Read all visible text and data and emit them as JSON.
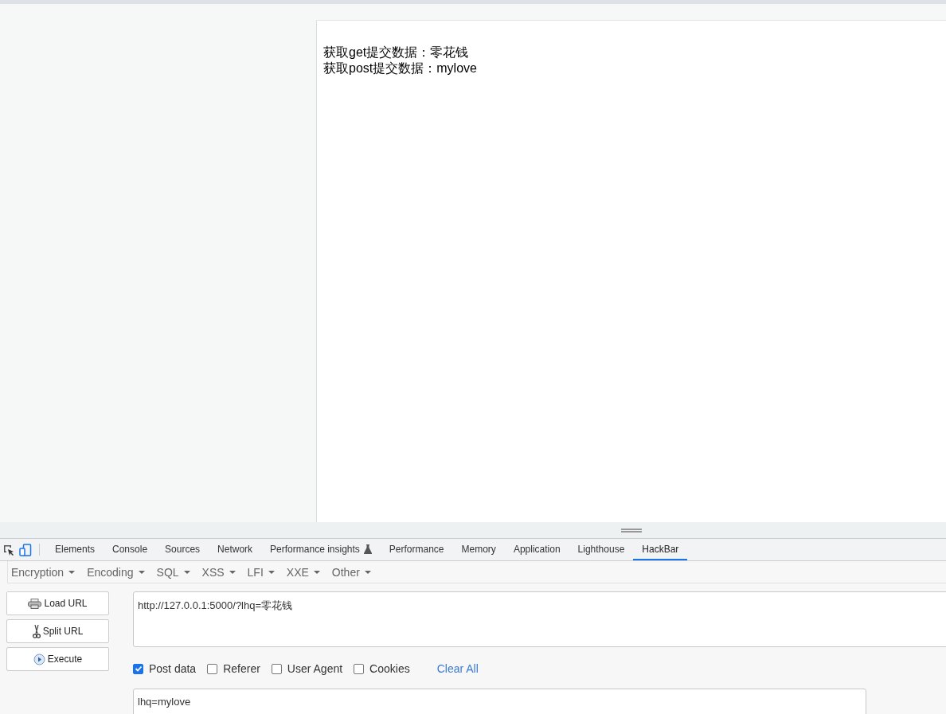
{
  "page": {
    "lines": [
      "获取get提交数据：零花钱",
      "获取post提交数据：mylove"
    ]
  },
  "devtools_tabs": [
    {
      "label": "Elements",
      "selected": false,
      "experimental": false
    },
    {
      "label": "Console",
      "selected": false,
      "experimental": false
    },
    {
      "label": "Sources",
      "selected": false,
      "experimental": false
    },
    {
      "label": "Network",
      "selected": false,
      "experimental": false
    },
    {
      "label": "Performance insights",
      "selected": false,
      "experimental": true
    },
    {
      "label": "Performance",
      "selected": false,
      "experimental": false
    },
    {
      "label": "Memory",
      "selected": false,
      "experimental": false
    },
    {
      "label": "Application",
      "selected": false,
      "experimental": false
    },
    {
      "label": "Lighthouse",
      "selected": false,
      "experimental": false
    },
    {
      "label": "HackBar",
      "selected": true,
      "experimental": false
    }
  ],
  "hackbar": {
    "menus": [
      "Encryption",
      "Encoding",
      "SQL",
      "XSS",
      "LFI",
      "XXE",
      "Other"
    ],
    "buttons": [
      {
        "label": "Load URL",
        "kind": "load"
      },
      {
        "label": "Split URL",
        "kind": "split"
      },
      {
        "label": "Execute",
        "kind": "execute"
      }
    ],
    "url": "http://127.0.0.1:5000/?lhq=零花钱",
    "options": [
      {
        "label": "Post data",
        "checked": true
      },
      {
        "label": "Referer",
        "checked": false
      },
      {
        "label": "User Agent",
        "checked": false
      },
      {
        "label": "Cookies",
        "checked": false
      }
    ],
    "clear_all": "Clear All",
    "post_body": "lhq=mylove"
  }
}
